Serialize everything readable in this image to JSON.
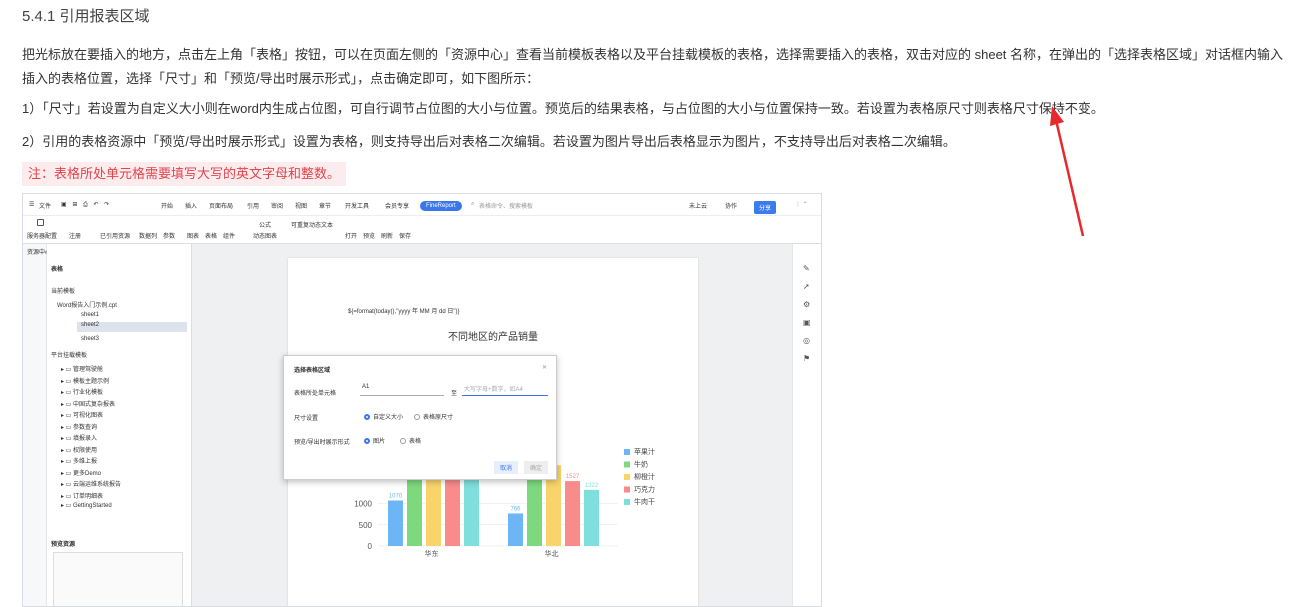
{
  "doc": {
    "heading": "5.4.1 引用报表区域",
    "para1": "把光标放在要插入的地方，点击左上角「表格」按钮，可以在页面左侧的「资源中心」查看当前模板表格以及平台挂载模板的表格，选择需要插入的表格，双击对应的 sheet 名称，在弹出的「选择表格区域」对话框内输入插入的表格位置，选择「尺寸」和「预览/导出时展示形式」，点击确定即可，如下图所示：",
    "para2": "1）「尺寸」若设置为自定义大小则在word内生成占位图，可自行调节占位图的大小与位置。预览后的结果表格，与占位图的大小与位置保持一致。若设置为表格原尺寸则表格尺寸保持不变。",
    "para3": "2）引用的表格资源中「预览/导出时展示形式」设置为表格，则支持导出后对表格二次编辑。若设置为图片导出后表格显示为图片，不支持导出后对表格二次编辑。",
    "note": "注：表格所处单元格需要填写大写的英文字母和整数。"
  },
  "app": {
    "menu": [
      "文件",
      "开始",
      "插入",
      "页面布局",
      "引用",
      "审阅",
      "视图",
      "章节",
      "开发工具",
      "会员专享"
    ],
    "brand": "FineReport",
    "search_placeholder": "表格命令、搜索模板",
    "not_cloud": "未上云",
    "collab": "协作",
    "share": "分享",
    "ribbon": [
      {
        "label": "服务器配置"
      },
      {
        "label": "注册"
      },
      {
        "label": "已引用资源"
      },
      {
        "label": "数据列"
      },
      {
        "label": "参数"
      },
      {
        "label": "图表"
      },
      {
        "label": "表格"
      },
      {
        "label": "组件"
      },
      {
        "label": "公式"
      },
      {
        "label": "动态图表"
      },
      {
        "label": "可重复动态文本"
      },
      {
        "label": "打开"
      },
      {
        "label": "预览"
      },
      {
        "label": "刷新"
      },
      {
        "label": "保存"
      }
    ],
    "resource_center": "资源中心",
    "panel_tab": "表格",
    "current_template": "当前模板",
    "current_file": "Word报告入门示例.cpt",
    "sheets": [
      "sheet1",
      "sheet2",
      "sheet3"
    ],
    "platform_templates": "平台挂载模板",
    "folders": [
      "管理驾驶舱",
      "模板主题示例",
      "行业化模板",
      "中国式复杂报表",
      "可视化图表",
      "参数查询",
      "填报录入",
      "权限使用",
      "多维上报",
      "更多Demo",
      "云端运维系统报告",
      "订单明细表",
      "GettingStarted"
    ],
    "preview_resources": "预览资源",
    "page_formula": "${=format(today(),\"yyyy 年 MM 月 dd 日\")}",
    "chart_title": "不同地区的产品销量",
    "dialog": {
      "title": "选择表格区域",
      "cell_label": "表格所处单元格",
      "start_value": "A1",
      "to": "至",
      "end_placeholder": "大写字母+数字，如A4",
      "size_label": "尺寸设置",
      "size_custom": "自定义大小",
      "size_original": "表格原尺寸",
      "display_label": "预览/导出时展示形式",
      "display_image": "图片",
      "display_table": "表格",
      "cancel": "取消",
      "confirm": "确定"
    }
  },
  "chart_data": {
    "type": "bar",
    "title": "不同地区的产品销量",
    "categories": [
      "华东",
      "华北"
    ],
    "y_ticks": [
      0,
      500,
      1000
    ],
    "ylim": [
      0,
      2000
    ],
    "series": [
      {
        "name": "苹果汁",
        "values": [
          1070,
          766
        ],
        "color": "#6cb6f5"
      },
      {
        "name": "牛奶",
        "values": [
          1700,
          1900
        ],
        "color": "#7ed87e"
      },
      {
        "name": "柳橙汁",
        "values": [
          1700,
          1900
        ],
        "color": "#f8d46a"
      },
      {
        "name": "巧克力",
        "values": [
          1700,
          1527
        ],
        "color": "#f98b8b"
      },
      {
        "name": "牛肉干",
        "values": [
          1700,
          1322
        ],
        "color": "#7fdfdd"
      }
    ],
    "data_labels": [
      "1070",
      "766",
      "1527",
      "1322"
    ]
  }
}
